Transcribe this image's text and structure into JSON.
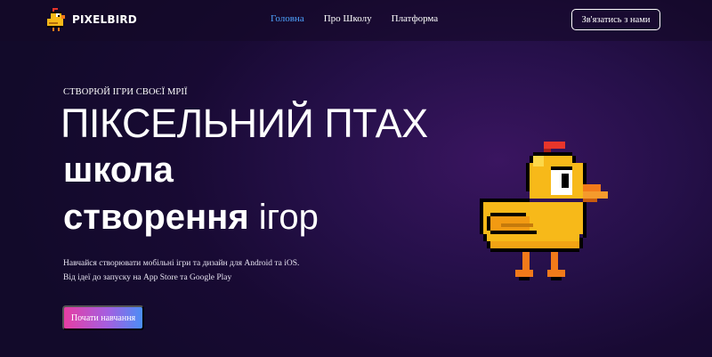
{
  "header": {
    "logo_text": "PIXELBIRD",
    "nav": [
      {
        "label": "Головна",
        "active": true
      },
      {
        "label": "Про Школу",
        "active": false
      },
      {
        "label": "Платформа",
        "active": false
      }
    ],
    "contact_button": "Зв'язатись з нами"
  },
  "hero": {
    "eyebrow": "СТВОРЮЙ ІГРИ СВОЄЇ МРІЇ",
    "title_line1": "ПІКСЕЛЬНИЙ ПТАХ",
    "title_line2": "школа",
    "title_line3_bold": "створення",
    "title_line3_rest": " ігор",
    "description_line1": "Навчайся створювати мобільні ігри та дизайн для Android та iOS.",
    "description_line2": "Від ідеї до запуску на App Store та Google Play",
    "cta_button": "Почати навчання"
  },
  "icons": {
    "logo": "pixel-chick-icon",
    "hero_image": "pixel-chick-illustration"
  },
  "colors": {
    "background": "#180a33",
    "nav_active": "#4ea2ff",
    "cta_gradient_start": "#e63ea3",
    "cta_gradient_end": "#4b8ef5",
    "bird_body": "#f7b919",
    "bird_beak": "#f27a1a",
    "bird_comb": "#e8352b"
  }
}
